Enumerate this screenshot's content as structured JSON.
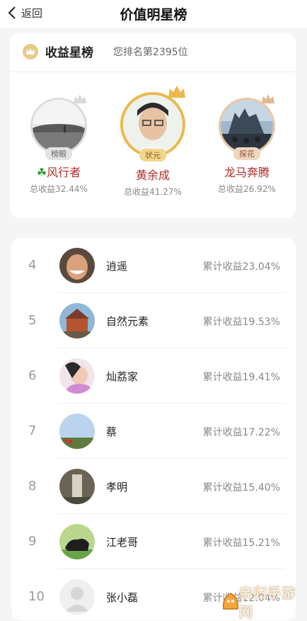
{
  "nav": {
    "back_label": "返回",
    "title": "价值明星榜"
  },
  "board": {
    "title": "收益星榜",
    "my_rank": "您排名第2395位",
    "podium": [
      {
        "tag": "榜眼",
        "name": "风行者",
        "gain": "总收益32.44%"
      },
      {
        "tag": "状元",
        "name": "黄余成",
        "gain": "总收益41.27%"
      },
      {
        "tag": "探花",
        "name": "龙马奔腾",
        "gain": "总收益26.92%"
      }
    ]
  },
  "list": [
    {
      "rank": "4",
      "name": "逍遥",
      "gain": "累计收益23.04%"
    },
    {
      "rank": "5",
      "name": "自然元素",
      "gain": "累计收益19.53%"
    },
    {
      "rank": "6",
      "name": "灿荔家",
      "gain": "累计收益19.41%"
    },
    {
      "rank": "7",
      "name": "蔡",
      "gain": "累计收益17.22%"
    },
    {
      "rank": "8",
      "name": "孝明",
      "gain": "累计收益15.40%"
    },
    {
      "rank": "9",
      "name": "江老哥",
      "gain": "累计收益15.21%"
    },
    {
      "rank": "10",
      "name": "张小磊",
      "gain": "累计收益12.04%"
    }
  ],
  "watermark": {
    "text": "亲归手游网"
  },
  "colors": {
    "gold": "#e9b94c",
    "name_red": "#b22a2a",
    "clover": "#2e9a3c"
  }
}
